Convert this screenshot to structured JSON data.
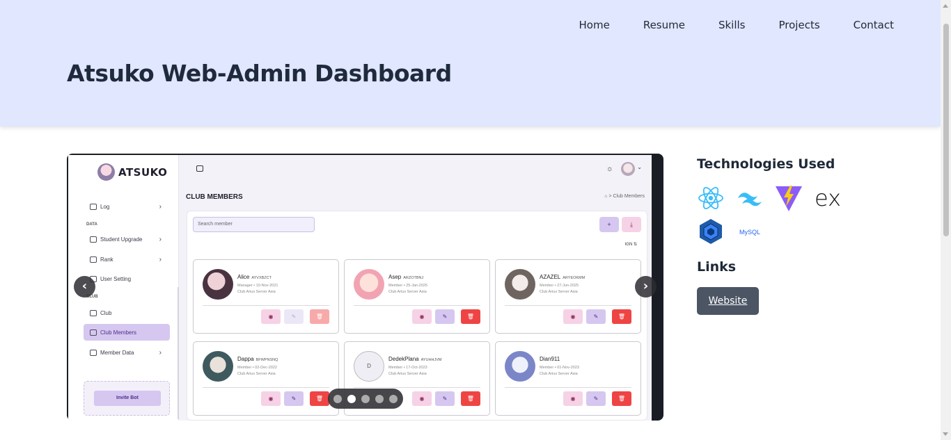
{
  "nav": [
    "Home",
    "Resume",
    "Skills",
    "Projects",
    "Contact"
  ],
  "project": {
    "title": "Atsuko Web-Admin Dashboard"
  },
  "screenshot": {
    "brand": "ATSUKO",
    "sidebar": {
      "log": "Log",
      "section_data": "DATA",
      "student_upgrade": "Student Upgrade",
      "rank": "Rank",
      "user_setting": "User Setting",
      "section_club": "CLUB",
      "club": "Club",
      "club_members": "Club Members",
      "member_data": "Member Data",
      "invite_bot": "Invite Bot"
    },
    "page_title": "CLUB MEMBERS",
    "breadcrumb": "⌂  >  Club Members",
    "search_placeholder": "Search member",
    "sort_label": "IGN",
    "members": [
      {
        "name": "Alice",
        "code": "AYVXBZCT",
        "role": "Manager • 10-Nov-2021",
        "server": "Club Arius Server Asia"
      },
      {
        "name": "Asep",
        "code": "ARZOTBNJ",
        "role": "Member • 25-Jan-2025",
        "server": "Club Arius Server Asia"
      },
      {
        "name": "AZAZEL",
        "code": "ARYEOKMM",
        "role": "Member • 27-Jun-2025",
        "server": "Club Arius Server Asia"
      },
      {
        "name": "Dappa",
        "code": "BFWPNSNQ",
        "role": "Member • 02-Dec-2022",
        "server": "Club Arius Server Asia"
      },
      {
        "name": "DedekPlana",
        "code": "AYUHHJVM",
        "role": "Member • 17-Oct-2023",
        "server": "Club Arius Server Asia",
        "initial": "D"
      },
      {
        "name": "Dian911",
        "code": "",
        "role": "Member • 01-Nov-2023",
        "server": "Club Arius Server Asia"
      }
    ],
    "carousel": {
      "slides": 5,
      "active": 2
    }
  },
  "technologies": {
    "heading": "Technologies Used",
    "items": [
      "react-icon",
      "tailwind-icon",
      "vite-icon",
      "express-icon",
      "sequelize-icon",
      "mysql-icon"
    ],
    "express_text": "ex",
    "mysql_text": "MySQL"
  },
  "links": {
    "heading": "Links",
    "website": "Website"
  }
}
